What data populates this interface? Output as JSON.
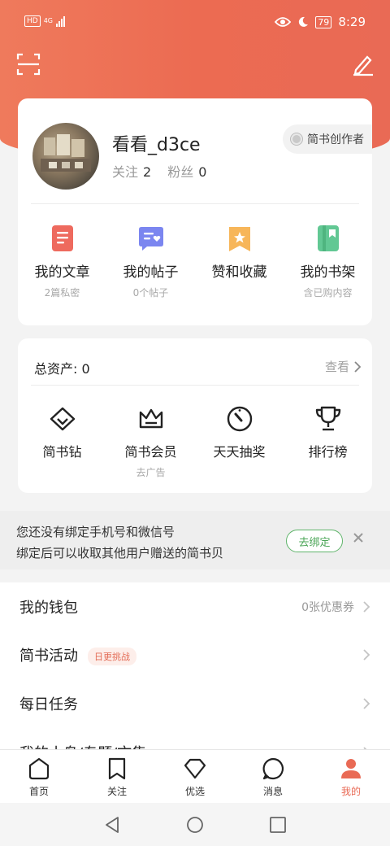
{
  "status": {
    "hd": "HD",
    "network": "4G",
    "battery": "79",
    "time": "8:29"
  },
  "profile": {
    "username": "看看_d3ce",
    "following_label": "关注",
    "following_count": "2",
    "fans_label": "粉丝",
    "fans_count": "0",
    "creator_badge": "简书创作者"
  },
  "quick_items": [
    {
      "label": "我的文章",
      "sub": "2篇私密",
      "icon": "article-icon",
      "color": "#ee6a5e"
    },
    {
      "label": "我的帖子",
      "sub": "0个帖子",
      "icon": "post-icon",
      "color": "#7b86f0"
    },
    {
      "label": "赞和收藏",
      "sub": "",
      "icon": "star-bookmark-icon",
      "color": "#f7b65a"
    },
    {
      "label": "我的书架",
      "sub": "含已购内容",
      "icon": "bookshelf-icon",
      "color": "#62c894"
    }
  ],
  "assets": {
    "title": "总资产: 0",
    "view": "查看",
    "items": [
      {
        "label": "简书钻",
        "sub": "",
        "icon": "diamond-icon"
      },
      {
        "label": "简书会员",
        "sub": "去广告",
        "icon": "crown-icon"
      },
      {
        "label": "天天抽奖",
        "sub": "",
        "icon": "dial-icon"
      },
      {
        "label": "排行榜",
        "sub": "",
        "icon": "trophy-icon"
      }
    ]
  },
  "bind_banner": {
    "line1": "您还没有绑定手机号和微信号",
    "line2": "绑定后可以收取其他用户赠送的简书贝",
    "button": "去绑定"
  },
  "menu": [
    {
      "label": "我的钱包",
      "right": "0张优惠券",
      "tag": ""
    },
    {
      "label": "简书活动",
      "right": "",
      "tag": "日更挑战"
    },
    {
      "label": "每日任务",
      "right": "",
      "tag": ""
    },
    {
      "label": "我的小岛/专题/文集",
      "right": "",
      "tag": ""
    }
  ],
  "tabs": [
    {
      "label": "首页"
    },
    {
      "label": "关注"
    },
    {
      "label": "优选"
    },
    {
      "label": "消息"
    },
    {
      "label": "我的"
    }
  ],
  "colors": {
    "accent": "#e96a55",
    "green": "#4aa556"
  }
}
